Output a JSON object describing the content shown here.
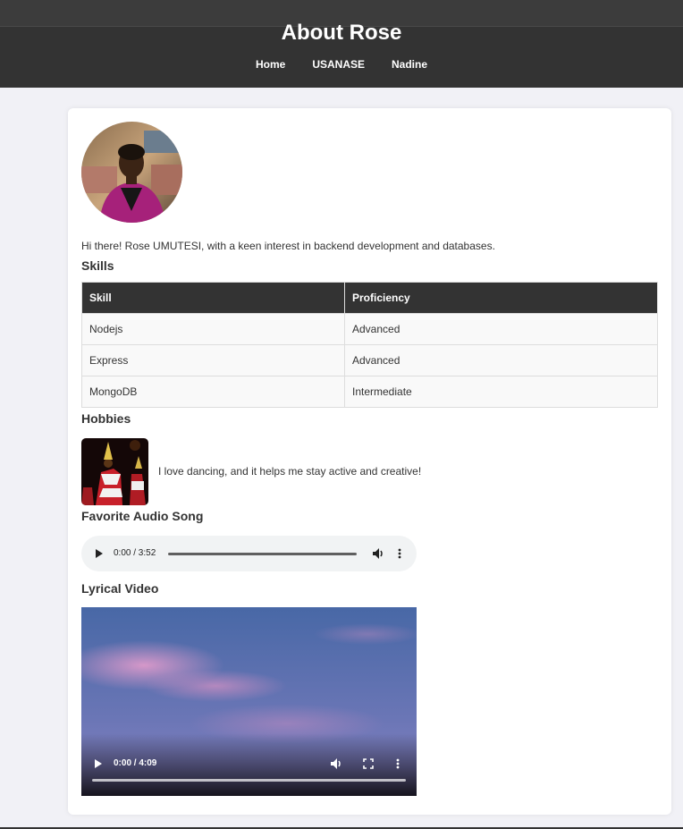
{
  "header": {
    "title": "About Rose",
    "nav": [
      "Home",
      "USANASE",
      "Nadine"
    ]
  },
  "profile": {
    "avatar_icon": "profile-photo",
    "intro": "Hi there! Rose UMUTESI, with a keen interest in backend development and databases."
  },
  "skills": {
    "title": "Skills",
    "headers": [
      "Skill",
      "Proficiency"
    ],
    "rows": [
      [
        "Nodejs",
        "Advanced"
      ],
      [
        "Express",
        "Advanced"
      ],
      [
        "MongoDB",
        "Intermediate"
      ]
    ]
  },
  "hobbies": {
    "title": "Hobbies",
    "image_icon": "dancers-photo",
    "text": "I love dancing, and it helps me stay active and creative!"
  },
  "audio": {
    "title": "Favorite Audio Song",
    "time": "0:00 / 3:52",
    "progress": 0
  },
  "video": {
    "title": "Lyrical Video",
    "time": "0:00 / 4:09",
    "progress": 0
  },
  "colors": {
    "header_bg": "#333333",
    "page_bg": "#f1f1f6",
    "table_header_bg": "#333333"
  }
}
